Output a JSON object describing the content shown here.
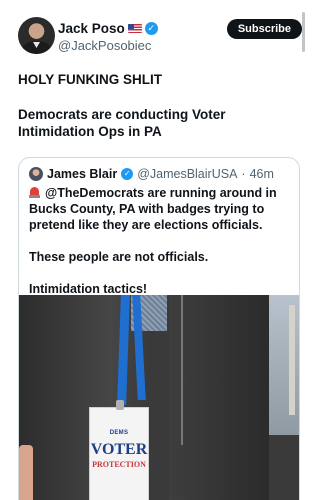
{
  "post": {
    "author_name": "Jack Poso",
    "author_handle": "@JackPosobiec",
    "flag_icon": "us-flag-icon",
    "verified_icon": "verified-check-icon",
    "subscribe_label": "Subscribe",
    "text_line1": "HOLY FUNKING SHLIT",
    "text_line2": "Democrats are conducting Voter Intimidation Ops in PA"
  },
  "quoted_post": {
    "author_name": "James Blair",
    "author_handle": "@JamesBlairUSA",
    "separator": "·",
    "time": "46m",
    "verified_icon": "verified-check-icon",
    "siren_icon": "police-siren-icon",
    "text_line1": "@TheDemocrats are running around in Bucks County, PA with badges trying to pretend like they are elections officials.",
    "text_line2": "These people are not officials.",
    "text_line3": "Intimidation tactics!",
    "image": {
      "badge_logo": "DEMS",
      "badge_title": "VOTER",
      "badge_subtitle": "PROTECTION"
    }
  },
  "colors": {
    "accent_blue": "#1d9bf0",
    "text_primary": "#0f1419",
    "text_secondary": "#536471",
    "border": "#cfd9de",
    "subscribe_bg": "#0f1419"
  }
}
